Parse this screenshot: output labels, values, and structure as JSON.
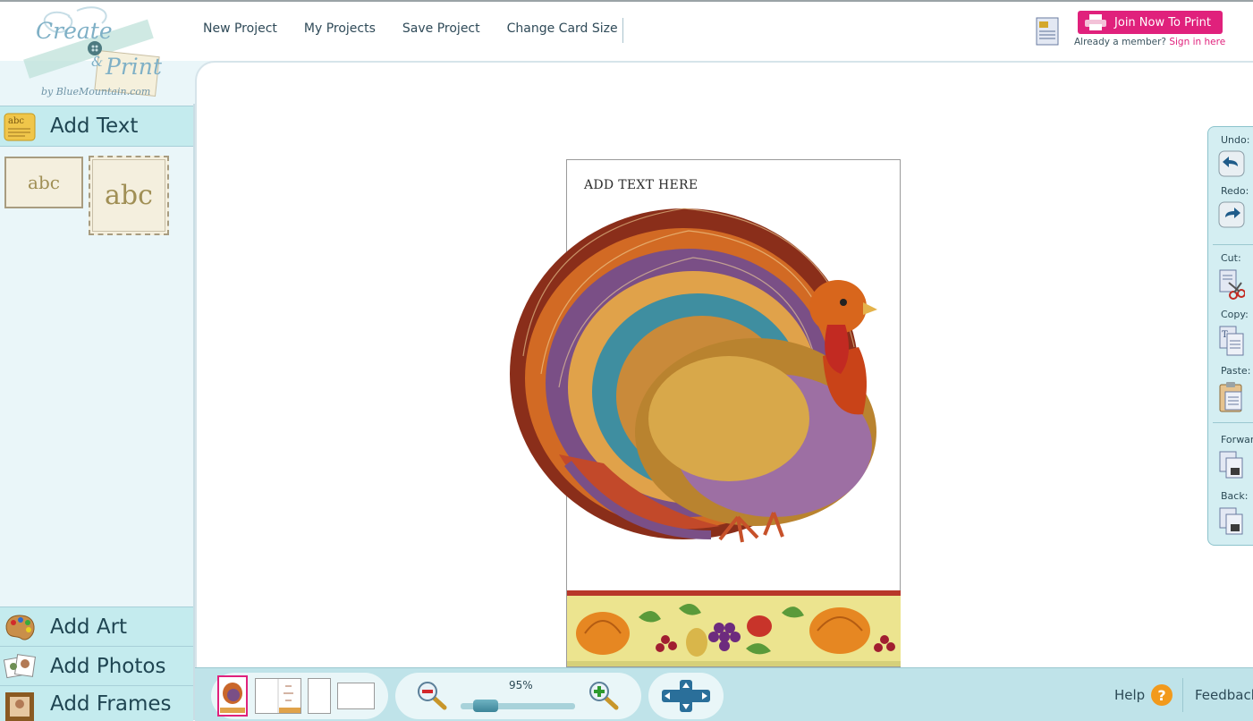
{
  "brand": {
    "line1": "Create",
    "amp": "&",
    "line2": "Print",
    "byline": "by BlueMountain.com"
  },
  "nav": {
    "items": [
      {
        "label": "New Project"
      },
      {
        "label": "My Projects"
      },
      {
        "label": "Save Project"
      },
      {
        "label": "Change Card Size"
      }
    ]
  },
  "header": {
    "join_label": "Join Now To Print",
    "already_member": "Already a member? ",
    "sign_in": "Sign in here"
  },
  "sidebar": {
    "add_text": "Add Text",
    "abc_small": "abc",
    "abc_large": "abc",
    "add_art": "Add Art",
    "add_photos": "Add Photos",
    "add_frames": "Add Frames"
  },
  "card": {
    "text": "ADD TEXT HERE"
  },
  "tools": {
    "undo": "Undo:",
    "redo": "Redo:",
    "cut": "Cut:",
    "copy": "Copy:",
    "paste": "Paste:",
    "forward": "Forward:",
    "back": "Back:"
  },
  "bottom": {
    "zoom": "95%",
    "zoom_level": 0.25,
    "help": "Help",
    "help_icon": "?",
    "feedback": "Feedback"
  },
  "colors": {
    "accent": "#e0217c",
    "panel": "#c4ebee",
    "background": "#eaf6f9"
  }
}
